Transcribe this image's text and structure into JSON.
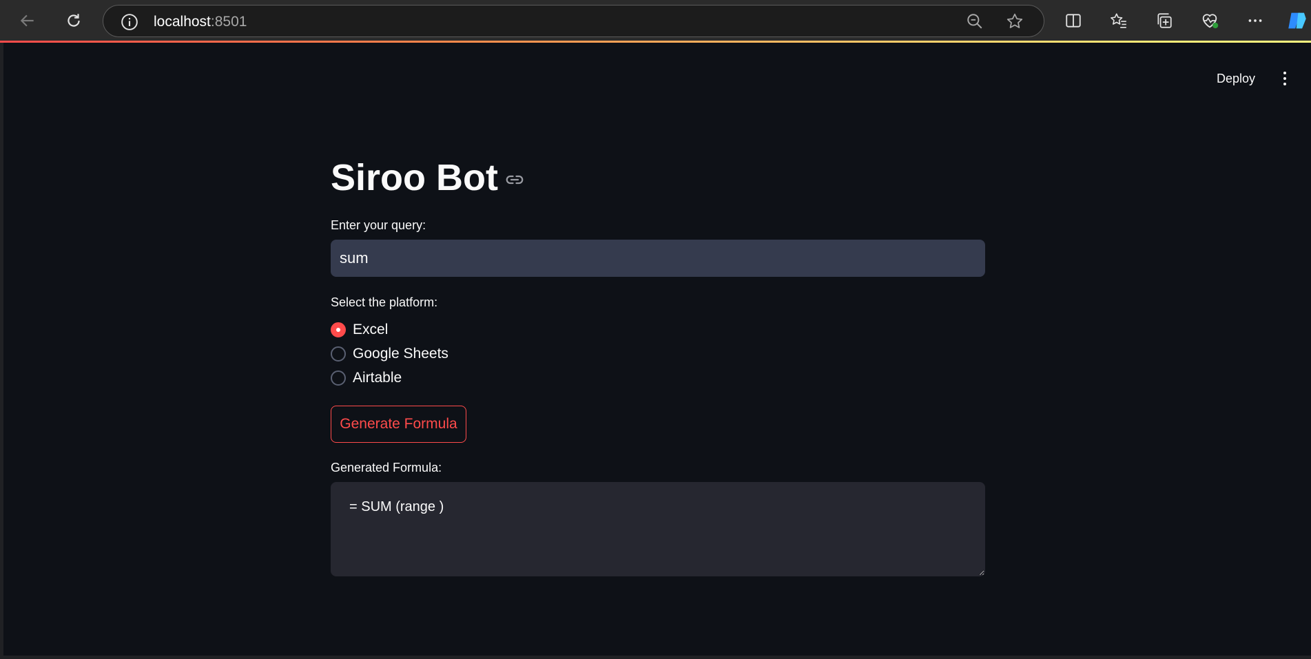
{
  "browser": {
    "url_host": "localhost",
    "url_port": ":8501"
  },
  "app_header": {
    "deploy_label": "Deploy"
  },
  "main": {
    "title": "Siroo Bot",
    "query_label": "Enter your query:",
    "query_value": "sum",
    "platform_label": "Select the platform:",
    "platform_options": [
      {
        "label": "Excel",
        "selected": true
      },
      {
        "label": "Google Sheets",
        "selected": false
      },
      {
        "label": "Airtable",
        "selected": false
      }
    ],
    "generate_label": "Generate Formula",
    "formula_label": "Generated Formula:",
    "formula_value": "= SUM (range )"
  },
  "colors": {
    "app_background": "#0e1117",
    "accent": "#ff4b4b",
    "input_background": "#353b4e",
    "textarea_background": "#262730"
  }
}
